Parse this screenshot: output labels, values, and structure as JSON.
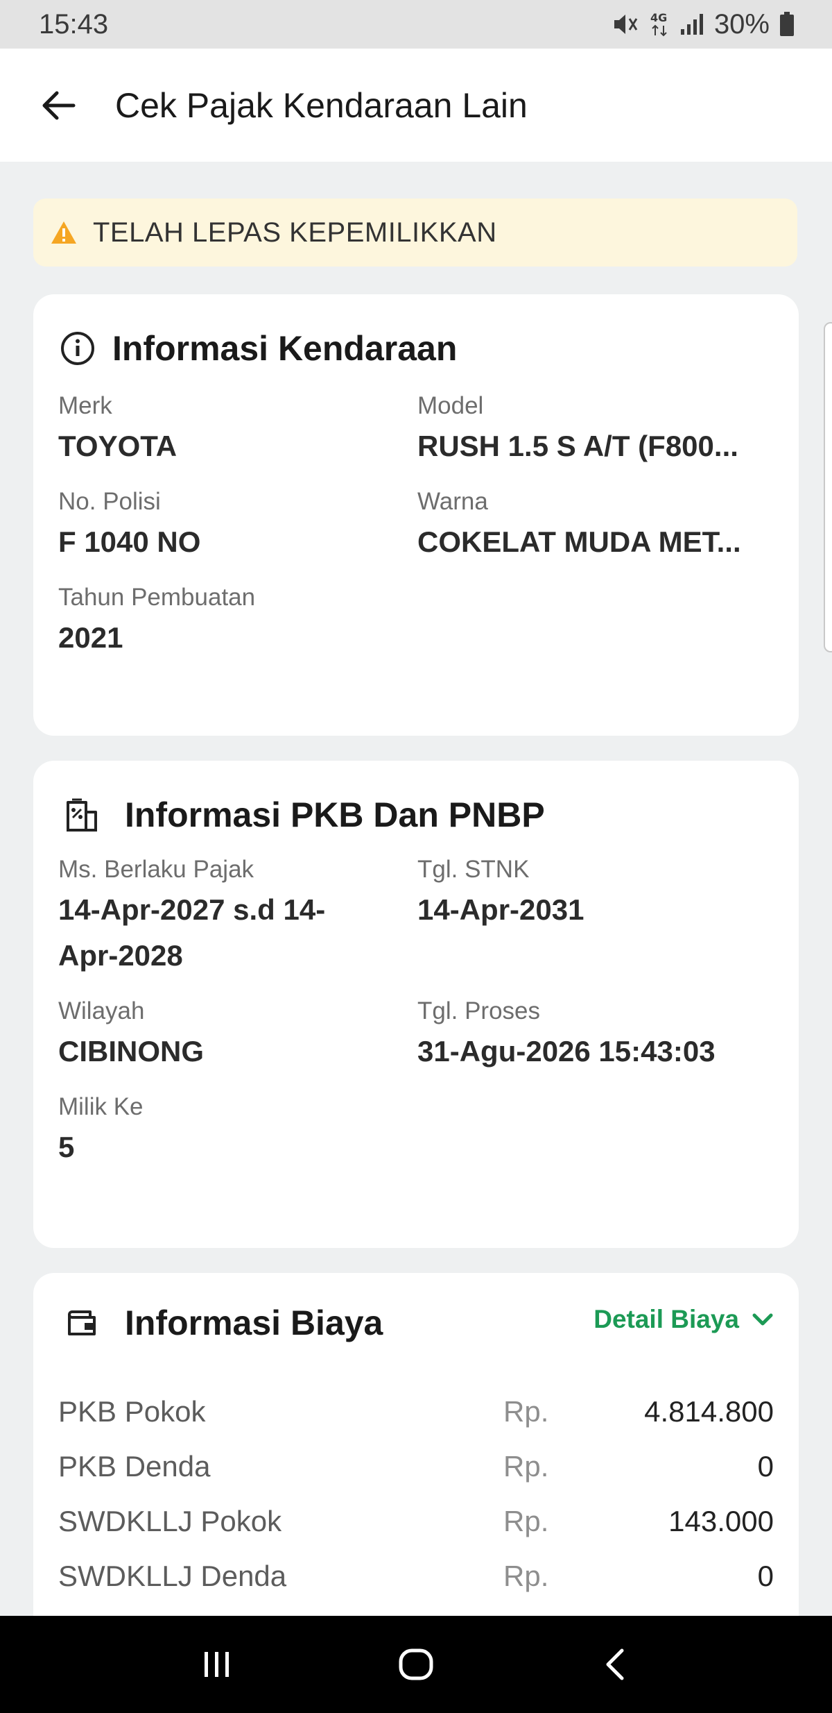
{
  "status_bar": {
    "time": "15:43",
    "battery": "30%",
    "icons": [
      "mute-icon",
      "4g-icon",
      "signal-icon",
      "battery-icon"
    ]
  },
  "app_bar": {
    "title": "Cek Pajak Kendaraan Lain",
    "back_icon": "arrow-left-icon"
  },
  "alert": {
    "text": "TELAH LEPAS KEPEMILIKKAN",
    "icon": "warning-icon",
    "color": "#f5a623"
  },
  "vehicle_info": {
    "title": "Informasi Kendaraan",
    "icon": "info-icon",
    "fields": [
      {
        "label": "Merk",
        "value": "TOYOTA"
      },
      {
        "label": "Model",
        "value": "RUSH 1.5 S A/T (F800..."
      },
      {
        "label": "No. Polisi",
        "value": "F 1040 NO"
      },
      {
        "label": "Warna",
        "value": "COKELAT MUDA MET..."
      },
      {
        "label": "Tahun Pembuatan",
        "value": "2021"
      }
    ]
  },
  "pkb_info": {
    "title": "Informasi PKB Dan PNBP",
    "icon": "tax-building-icon",
    "fields": [
      {
        "label": "Ms. Berlaku Pajak",
        "value": "14-Apr-2027 s.d 14-Apr-2028"
      },
      {
        "label": "Tgl. STNK",
        "value": "14-Apr-2031"
      },
      {
        "label": "Wilayah",
        "value": "CIBINONG"
      },
      {
        "label": "Tgl. Proses",
        "value": "31-Agu-2026 15:43:03"
      },
      {
        "label": "Milik Ke",
        "value": "5"
      }
    ]
  },
  "cost_info": {
    "title": "Informasi Biaya",
    "icon": "wallet-icon",
    "detail_label": "Detail Biaya",
    "accent": "#1c9a55",
    "rows": [
      {
        "name": "PKB Pokok",
        "currency": "Rp.",
        "amount": "4.814.800"
      },
      {
        "name": "PKB Denda",
        "currency": "Rp.",
        "amount": "0"
      },
      {
        "name": "SWDKLLJ Pokok",
        "currency": "Rp.",
        "amount": "143.000"
      },
      {
        "name": "SWDKLLJ Denda",
        "currency": "Rp.",
        "amount": "0"
      }
    ]
  },
  "nav_bar": {
    "buttons": [
      "recent-apps-icon",
      "home-icon",
      "back-icon"
    ]
  }
}
